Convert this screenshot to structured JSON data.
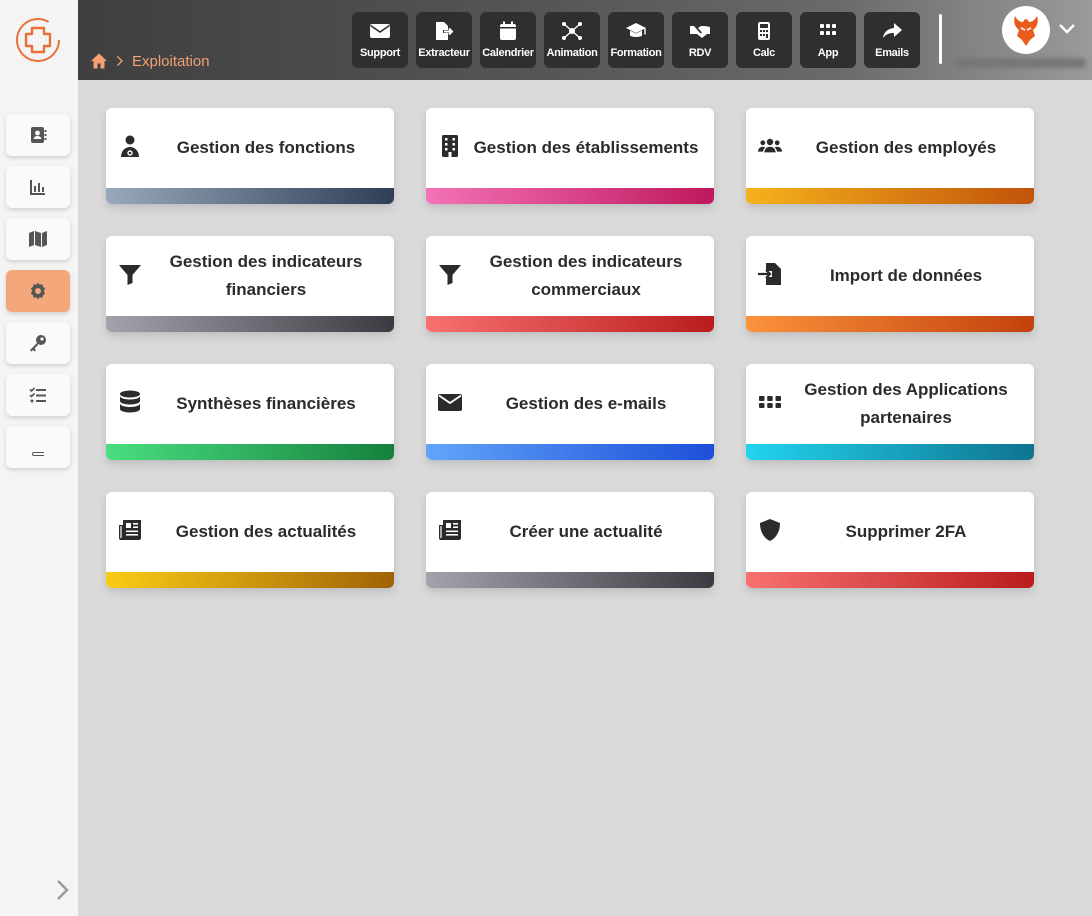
{
  "breadcrumb": {
    "current": "Exploitation"
  },
  "toolbar": [
    {
      "label": "Support",
      "icon": "envelope-icon"
    },
    {
      "label": "Extracteur",
      "icon": "file-export-icon"
    },
    {
      "label": "Calendrier",
      "icon": "calendar-icon"
    },
    {
      "label": "Animation",
      "icon": "network-icon"
    },
    {
      "label": "Formation",
      "icon": "graduation-cap-icon"
    },
    {
      "label": "RDV",
      "icon": "handshake-icon"
    },
    {
      "label": "Calc",
      "icon": "calculator-icon"
    },
    {
      "label": "App",
      "icon": "grid-icon"
    },
    {
      "label": "Emails",
      "icon": "share-icon"
    }
  ],
  "sidebar": [
    {
      "icon": "address-book-icon",
      "active": false
    },
    {
      "icon": "chart-icon",
      "active": false
    },
    {
      "icon": "map-icon",
      "active": false
    },
    {
      "icon": "gear-icon",
      "active": true
    },
    {
      "icon": "key-icon",
      "active": false
    },
    {
      "icon": "checklist-icon",
      "active": false
    },
    {
      "icon": "book-icon",
      "active": false
    }
  ],
  "cards": [
    {
      "title": "Gestion des fonctions",
      "icon": "user-doctor-icon",
      "gradient": [
        "#9aa8bd",
        "#2f3e55"
      ]
    },
    {
      "title": "Gestion des établissements",
      "icon": "building-icon",
      "gradient": [
        "#f472b6",
        "#be185d"
      ]
    },
    {
      "title": "Gestion des employés",
      "icon": "users-icon",
      "gradient": [
        "#f5b21c",
        "#c2530a"
      ]
    },
    {
      "title": "Gestion des indicateurs financiers",
      "icon": "filter-icon",
      "gradient": [
        "#a3a3ad",
        "#3a3a40"
      ]
    },
    {
      "title": "Gestion des indicateurs commerciaux",
      "icon": "filter-icon",
      "gradient": [
        "#f87171",
        "#b91c1c"
      ]
    },
    {
      "title": "Import de données",
      "icon": "file-import-icon",
      "gradient": [
        "#fb923c",
        "#c2410c"
      ]
    },
    {
      "title": "Synthèses financières",
      "icon": "database-icon",
      "gradient": [
        "#4ade80",
        "#15803d"
      ]
    },
    {
      "title": "Gestion des e-mails",
      "icon": "envelope-icon",
      "gradient": [
        "#60a5fa",
        "#1d4ed8"
      ]
    },
    {
      "title": "Gestion des Applications partenaires",
      "icon": "grid-icon",
      "gradient": [
        "#22d3ee",
        "#0e7490"
      ]
    },
    {
      "title": "Gestion des actualités",
      "icon": "newspaper-icon",
      "gradient": [
        "#facc15",
        "#a16207"
      ]
    },
    {
      "title": "Créer une actualité",
      "icon": "newspaper-icon",
      "gradient": [
        "#a3a3ad",
        "#3a3a40"
      ]
    },
    {
      "title": "Supprimer 2FA",
      "icon": "shield-icon",
      "gradient": [
        "#f87171",
        "#b91c1c"
      ]
    }
  ],
  "colors": {
    "accent": "#f4a070",
    "active_sidebar": "#f5a77c",
    "tool_bg": "#2f2f2f"
  }
}
